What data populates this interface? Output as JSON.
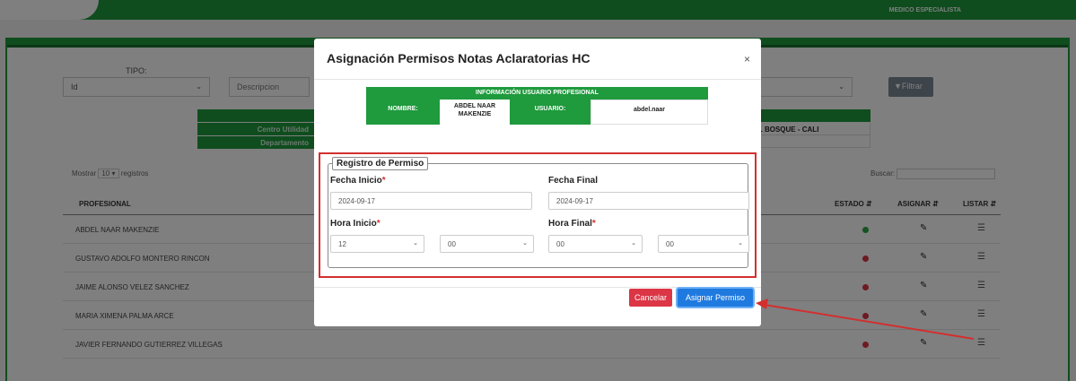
{
  "header": {
    "logo_text": "",
    "role": "MEDICO ESPECIALISTA"
  },
  "filters": {
    "tipo_label": "TIPO:",
    "tipo_value": "Id",
    "descripcion_placeholder": "Descripcion",
    "filtrar_label": "Filtrar"
  },
  "info_left": {
    "row1": "Centro Utilidad",
    "row2": "Departamento"
  },
  "info_right": {
    "row1": "L BOSQUE - CALI"
  },
  "table": {
    "mostrar_prefix": "Mostrar",
    "page_size": "10",
    "mostrar_suffix": "registros",
    "buscar_label": "Buscar:",
    "headers": {
      "profesional": "PROFESIONAL",
      "estado": "ESTADO",
      "asignar": "ASIGNAR",
      "listar": "LISTAR"
    },
    "rows": [
      {
        "name": "ABDEL NAAR MAKENZIE",
        "status_color": "#28a745"
      },
      {
        "name": "GUSTAVO ADOLFO MONTERO RINCON",
        "status_color": "#dc3545"
      },
      {
        "name": "JAIME ALONSO VELEZ SANCHEZ",
        "status_color": "#dc3545"
      },
      {
        "name": "MARIA XIMENA PALMA ARCE",
        "status_color": "#dc3545"
      },
      {
        "name": "JAVIER FERNANDO GUTIERREZ VILLEGAS",
        "status_color": "#dc3545"
      }
    ]
  },
  "modal": {
    "title": "Asignación Permisos Notas Aclaratorias HC",
    "close": "×",
    "user_info": {
      "header": "INFORMACIÓN USUARIO PROFESIONAL",
      "nombre_label": "NOMBRE:",
      "nombre_value": "ABDEL NAAR MAKENZIE",
      "usuario_label": "USUARIO:",
      "usuario_value": "abdel.naar"
    },
    "form": {
      "legend": "Registro de Permiso",
      "fecha_inicio_label": "Fecha Inicio",
      "fecha_inicio_value": "2024-09-17",
      "fecha_final_label": "Fecha Final",
      "fecha_final_value": "2024-09-17",
      "hora_inicio_label": "Hora Inicio",
      "hora_inicio_hour": "12",
      "hora_inicio_min": "00",
      "hora_final_label": "Hora Final",
      "hora_final_hour": "00",
      "hora_final_min": "00",
      "required_mark": "*"
    },
    "cancel_label": "Cancelar",
    "assign_label": "Asignar Permiso"
  },
  "colors": {
    "brand_green": "#1f9a3d",
    "danger": "#dc3545",
    "primary": "#1f7ae0",
    "annotation": "#d32f2f"
  }
}
